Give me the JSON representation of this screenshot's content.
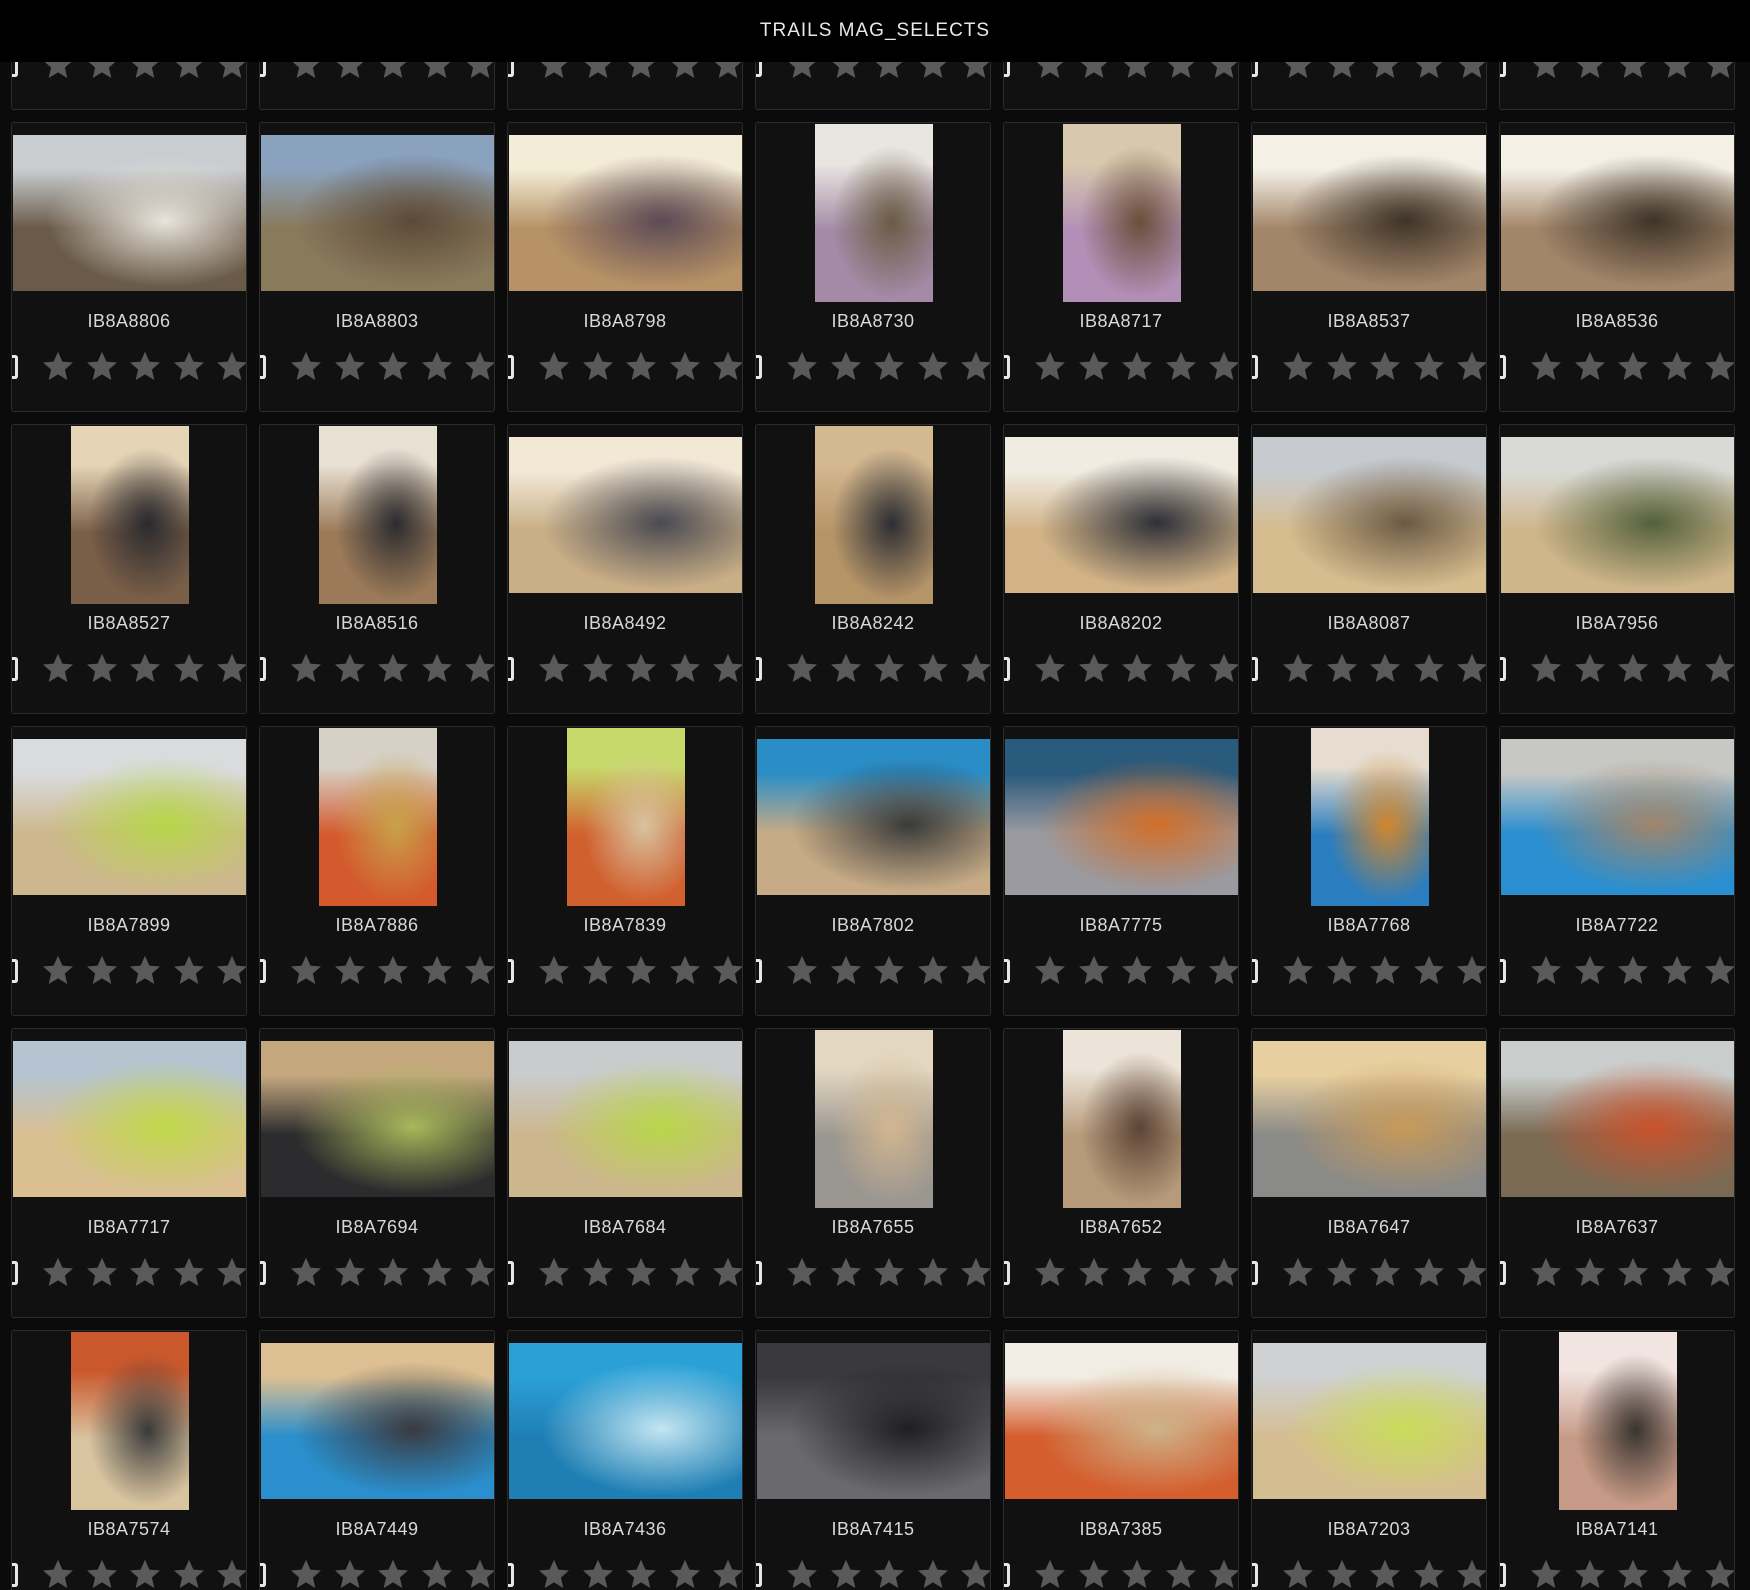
{
  "window": {
    "title": "TRAILS MAG_SELECTS"
  },
  "grid": {
    "rows": [
      [
        {
          "filename": "",
          "orientation": "landscape",
          "rating": 0
        },
        {
          "filename": "",
          "orientation": "landscape",
          "rating": 0
        },
        {
          "filename": "",
          "orientation": "landscape",
          "rating": 0
        },
        {
          "filename": "",
          "orientation": "landscape",
          "rating": 0
        },
        {
          "filename": "",
          "orientation": "landscape",
          "rating": 0
        },
        {
          "filename": "",
          "orientation": "landscape",
          "rating": 0
        },
        {
          "filename": "",
          "orientation": "landscape",
          "rating": 0
        }
      ],
      [
        {
          "filename": "IB8A8806",
          "orientation": "landscape",
          "colors": [
            "#c9cdd0",
            "#6a5a48",
            "#e8e4dc"
          ],
          "rating": 0
        },
        {
          "filename": "IB8A8803",
          "orientation": "landscape",
          "colors": [
            "#8aa2bd",
            "#8a7a5c",
            "#5c4a38"
          ],
          "rating": 0
        },
        {
          "filename": "IB8A8798",
          "orientation": "landscape",
          "colors": [
            "#f3ecd6",
            "#b79266",
            "#5c4a56"
          ],
          "rating": 0
        },
        {
          "filename": "IB8A8730",
          "orientation": "portrait",
          "colors": [
            "#e9e6e2",
            "#a48aa6",
            "#6a5c44"
          ],
          "rating": 0
        },
        {
          "filename": "IB8A8717",
          "orientation": "portrait",
          "colors": [
            "#d8c9ae",
            "#b28fb6",
            "#6a4f3a"
          ],
          "rating": 0
        },
        {
          "filename": "IB8A8537",
          "orientation": "landscape",
          "colors": [
            "#f4f0e6",
            "#a3866a",
            "#3e3328"
          ],
          "rating": 0
        },
        {
          "filename": "IB8A8536",
          "orientation": "landscape",
          "colors": [
            "#f4f0e6",
            "#a3866a",
            "#3e3328"
          ],
          "rating": 0
        }
      ],
      [
        {
          "filename": "IB8A8527",
          "orientation": "portrait",
          "colors": [
            "#e6d4b6",
            "#7a5f48",
            "#2a2a2e"
          ],
          "rating": 0
        },
        {
          "filename": "IB8A8516",
          "orientation": "portrait",
          "colors": [
            "#e8e0d2",
            "#9a7a58",
            "#2c2c30"
          ],
          "rating": 0
        },
        {
          "filename": "IB8A8492",
          "orientation": "landscape",
          "colors": [
            "#f2e8d6",
            "#c9ae86",
            "#4a4a52"
          ],
          "rating": 0
        },
        {
          "filename": "IB8A8242",
          "orientation": "portrait",
          "colors": [
            "#d4b890",
            "#b59468",
            "#2c2e34"
          ],
          "rating": 0
        },
        {
          "filename": "IB8A8202",
          "orientation": "landscape",
          "colors": [
            "#f1ece2",
            "#d2b387",
            "#2e3038"
          ],
          "rating": 0
        },
        {
          "filename": "IB8A8087",
          "orientation": "landscape",
          "colors": [
            "#c7cbd0",
            "#d6bc8e",
            "#6c5a44"
          ],
          "rating": 0
        },
        {
          "filename": "IB8A7956",
          "orientation": "landscape",
          "colors": [
            "#d9dad6",
            "#cfb58a",
            "#53613c"
          ],
          "rating": 0
        }
      ],
      [
        {
          "filename": "IB8A7899",
          "orientation": "landscape",
          "colors": [
            "#d9dbdc",
            "#cdb78f",
            "#b7d64a"
          ],
          "rating": 0
        },
        {
          "filename": "IB8A7886",
          "orientation": "portrait",
          "colors": [
            "#d6d0c6",
            "#d45a2e",
            "#c7a24a"
          ],
          "rating": 0
        },
        {
          "filename": "IB8A7839",
          "orientation": "portrait",
          "colors": [
            "#c7d86a",
            "#d1602f",
            "#d7c3a0"
          ],
          "rating": 0
        },
        {
          "filename": "IB8A7802",
          "orientation": "landscape",
          "colors": [
            "#2a8dc6",
            "#c6ab86",
            "#3a3a3a"
          ],
          "rating": 0
        },
        {
          "filename": "IB8A7775",
          "orientation": "landscape",
          "colors": [
            "#2a5a7c",
            "#9a9aa0",
            "#d16f2a"
          ],
          "rating": 0
        },
        {
          "filename": "IB8A7768",
          "orientation": "portrait",
          "colors": [
            "#e6ddd0",
            "#2a7dbf",
            "#d0862e"
          ],
          "rating": 0
        },
        {
          "filename": "IB8A7722",
          "orientation": "landscape",
          "colors": [
            "#c7c7c4",
            "#2a8fd0",
            "#a0856a"
          ],
          "rating": 0
        }
      ],
      [
        {
          "filename": "IB8A7717",
          "orientation": "landscape",
          "colors": [
            "#b5c4d0",
            "#d9bf92",
            "#c0d84a"
          ],
          "rating": 0
        },
        {
          "filename": "IB8A7694",
          "orientation": "landscape",
          "colors": [
            "#c5a77e",
            "#2c2c2e",
            "#a8b85a"
          ],
          "rating": 0
        },
        {
          "filename": "IB8A7684",
          "orientation": "landscape",
          "colors": [
            "#c9cbcc",
            "#ccb68e",
            "#b8d64a"
          ],
          "rating": 0
        },
        {
          "filename": "IB8A7655",
          "orientation": "portrait",
          "colors": [
            "#e3d7c2",
            "#9a9690",
            "#d2b690"
          ],
          "rating": 0
        },
        {
          "filename": "IB8A7652",
          "orientation": "portrait",
          "colors": [
            "#ece4d8",
            "#b79a7a",
            "#5c4436"
          ],
          "rating": 0
        },
        {
          "filename": "IB8A7647",
          "orientation": "landscape",
          "colors": [
            "#e8cfa0",
            "#8a8a88",
            "#c79a5a"
          ],
          "rating": 0
        },
        {
          "filename": "IB8A7637",
          "orientation": "landscape",
          "colors": [
            "#c9cdcc",
            "#7a6a54",
            "#c9532c"
          ],
          "rating": 0
        }
      ],
      [
        {
          "filename": "IB8A7574",
          "orientation": "portrait",
          "colors": [
            "#c9582d",
            "#d9c4a0",
            "#3a3a3a"
          ],
          "rating": 0
        },
        {
          "filename": "IB8A7449",
          "orientation": "landscape",
          "colors": [
            "#dcbf92",
            "#2a8fcc",
            "#3a3a40"
          ],
          "rating": 0
        },
        {
          "filename": "IB8A7436",
          "orientation": "landscape",
          "colors": [
            "#2aa0d6",
            "#1f7fb4",
            "#c3e6f2"
          ],
          "rating": 0
        },
        {
          "filename": "IB8A7415",
          "orientation": "landscape",
          "colors": [
            "#3a3a3e",
            "#6a6a6e",
            "#1f1f22"
          ],
          "rating": 0
        },
        {
          "filename": "IB8A7385",
          "orientation": "landscape",
          "colors": [
            "#f2ede4",
            "#d45e2e",
            "#cdb38a"
          ],
          "rating": 0
        },
        {
          "filename": "IB8A7203",
          "orientation": "landscape",
          "colors": [
            "#cfd1d2",
            "#d5bd92",
            "#c9dc5a"
          ],
          "rating": 0
        },
        {
          "filename": "IB8A7141",
          "orientation": "portrait",
          "colors": [
            "#f2e4e0",
            "#c69a86",
            "#3a3430"
          ],
          "rating": 0
        }
      ]
    ]
  },
  "icons": {
    "flag": "pick-flag-icon",
    "star": "star-icon"
  },
  "colors": {
    "titlebar_bg": "#000000",
    "grid_bg": "#0b0b0b",
    "card_bg": "#111111",
    "card_border": "#2c2c2c",
    "star_empty": "#5a5a5a",
    "text": "#d8d8d8"
  }
}
